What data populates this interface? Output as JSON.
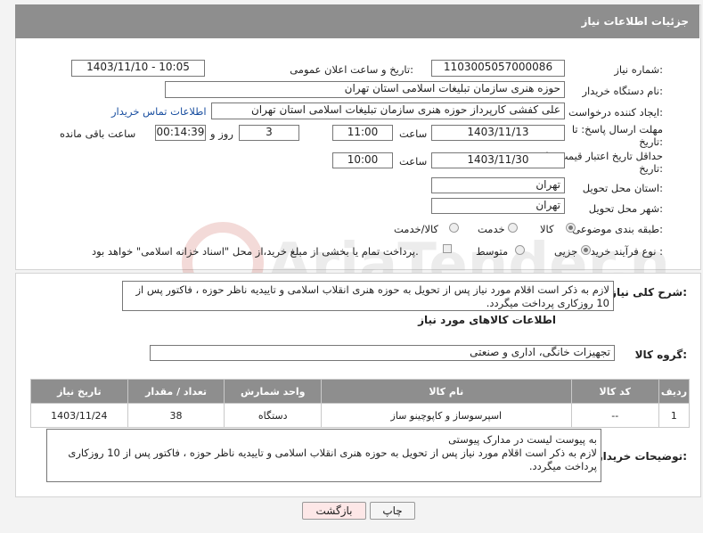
{
  "header": {
    "title": "جزئیات اطلاعات نیاز"
  },
  "form": {
    "need_number": {
      "label": "شماره نیاز:",
      "value": "1103005057000086"
    },
    "announce_datetime": {
      "label": "تاریخ و ساعت اعلان عمومی:",
      "value": "1403/11/10 - 10:05"
    },
    "buyer_org": {
      "label": "نام دستگاه خریدار:",
      "value": "حوزه هنری سازمان تبلیغات اسلامی استان تهران"
    },
    "requester": {
      "label": "ایجاد کننده درخواست:",
      "value": "علی کفشی کارپرداز حوزه هنری سازمان تبلیغات اسلامی استان تهران",
      "contact_link": "اطلاعات تماس خریدار"
    },
    "reply_deadline": {
      "label_line1": "مهلت ارسال پاسخ: تا",
      "label_line2": "تاریخ:",
      "date": "1403/11/13",
      "time_label": "ساعت",
      "time": "11:00",
      "days": "3",
      "days_label": "روز و",
      "remaining": "00:14:39",
      "remaining_label": "ساعت باقی مانده"
    },
    "price_validity": {
      "label_line1": "حداقل تاریخ اعتبار قیمت: تا",
      "label_line2": "تاریخ:",
      "date": "1403/11/30",
      "time_label": "ساعت",
      "time": "10:00"
    },
    "delivery_province": {
      "label": "استان محل تحویل:",
      "value": "تهران"
    },
    "delivery_city": {
      "label": "شهر محل تحویل:",
      "value": "تهران"
    },
    "category": {
      "label": "طبقه بندی موضوعی:",
      "options": [
        "کالا",
        "خدمت",
        "کالا/خدمت"
      ],
      "selected": "کالا"
    },
    "purchase_type": {
      "label": "نوع فرآیند خرید :",
      "options": [
        "جزیی",
        "متوسط"
      ],
      "selected": "جزیی",
      "note": "پرداخت تمام یا بخشی از مبلغ خرید،از محل \"اسناد خزانه اسلامی\" خواهد بود."
    }
  },
  "description": {
    "label": "شرح کلی نیاز:",
    "text": "لازم به ذکر است اقلام مورد نیاز پس از تحویل به حوزه هنری انقلاب اسلامی و تاییدیه ناظر حوزه ، فاکتور پس از 10 روزکاری پرداخت میگردد."
  },
  "items_section": {
    "title": "اطلاعات کالاهای مورد نیاز",
    "group_label": "گروه کالا:",
    "group_value": "تجهیزات خانگی، اداری و صنعتی",
    "columns": [
      "ردیف",
      "کد کالا",
      "نام کالا",
      "واحد شمارش",
      "تعداد / مقدار",
      "تاریخ نیاز"
    ],
    "rows": [
      [
        "1",
        "--",
        "اسپرسوساز و کاپوچینو ساز",
        "دستگاه",
        "38",
        "1403/11/24"
      ]
    ]
  },
  "buyer_notes": {
    "label": "توضیحات خریدار:",
    "line1": "به پیوست لیست در مدارک پیوستی",
    "line2": "لازم به ذکر است اقلام مورد نیاز پس از تحویل به حوزه هنری انقلاب اسلامی و تاییدیه ناظر حوزه ، فاکتور پس از 10 روزکاری پرداخت میگردد."
  },
  "buttons": {
    "print": "چاپ",
    "back": "بازگشت"
  },
  "watermark": {
    "text": "AriaTender.net"
  },
  "colors": {
    "header_bg": "#8e8e8e",
    "link": "#1a4fa0",
    "back_button_bg": "#fde7e7"
  }
}
